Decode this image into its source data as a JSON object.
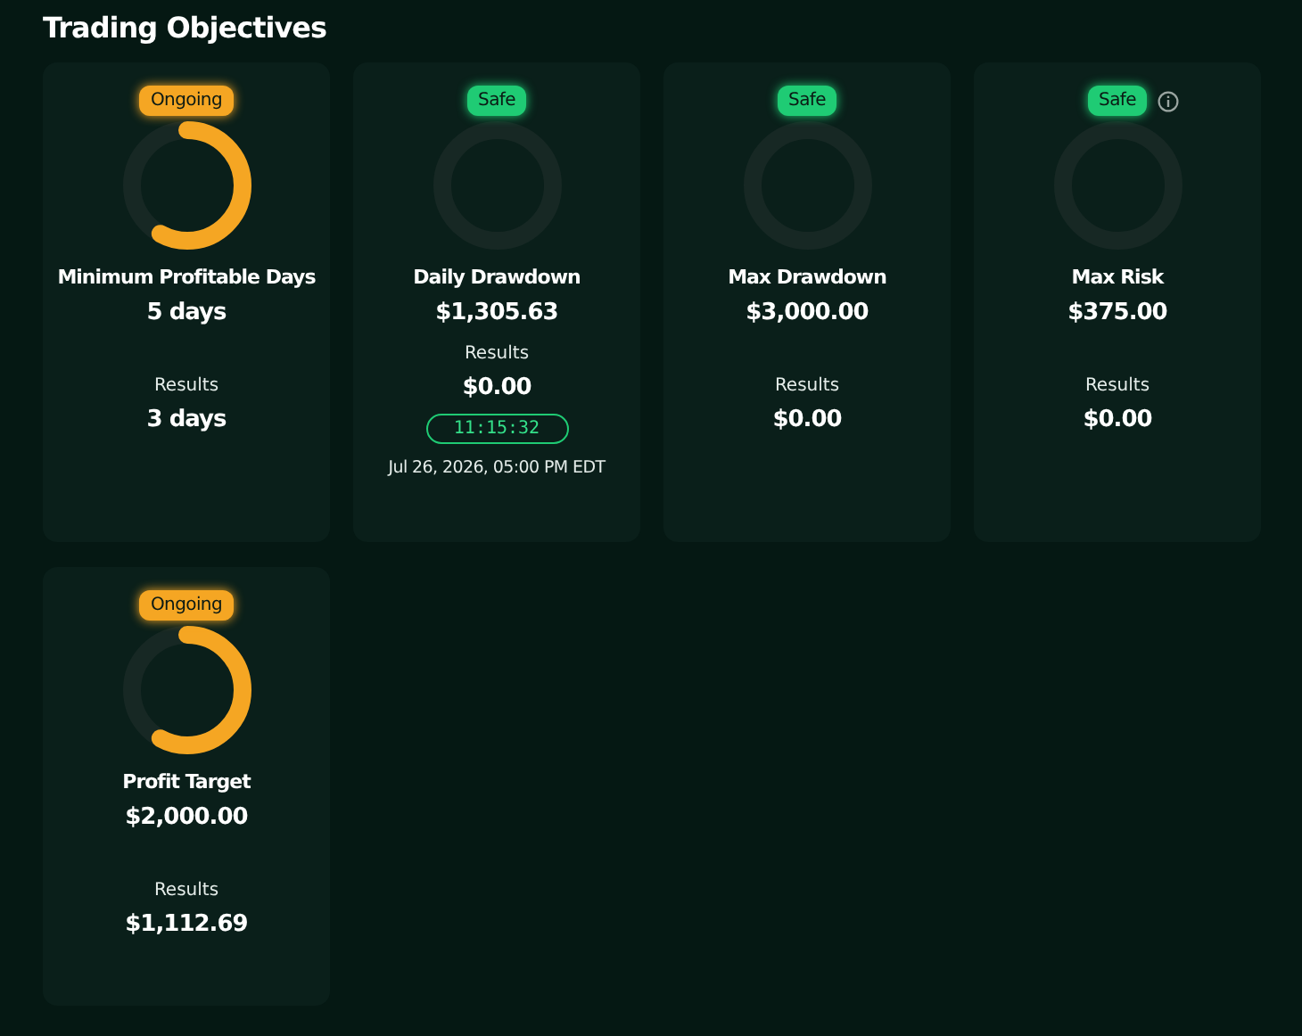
{
  "title": "Trading Objectives",
  "objectives": [
    {
      "status": {
        "kind": "ongoing",
        "label": "Ongoing"
      },
      "info": false,
      "name": "Minimum Profitable Days",
      "target": "5 days",
      "results_label": "Results",
      "result": "3 days"
    },
    {
      "status": {
        "kind": "safe",
        "label": "Safe"
      },
      "info": false,
      "name": "Daily Drawdown",
      "target": "$1,305.63",
      "results_label": "Results",
      "result": "$0.00",
      "timer": "11:15:32",
      "deadline": "Jul 26, 2026, 05:00 PM EDT"
    },
    {
      "status": {
        "kind": "safe",
        "label": "Safe"
      },
      "info": false,
      "name": "Max Drawdown",
      "target": "$3,000.00",
      "results_label": "Results",
      "result": "$0.00"
    },
    {
      "status": {
        "kind": "safe",
        "label": "Safe"
      },
      "info": true,
      "name": "Max Risk",
      "target": "$375.00",
      "results_label": "Results",
      "result": "$0.00"
    },
    {
      "status": {
        "kind": "ongoing",
        "label": "Ongoing"
      },
      "info": false,
      "name": "Profit Target",
      "target": "$2,000.00",
      "results_label": "Results",
      "result": "$1,112.69"
    }
  ]
}
